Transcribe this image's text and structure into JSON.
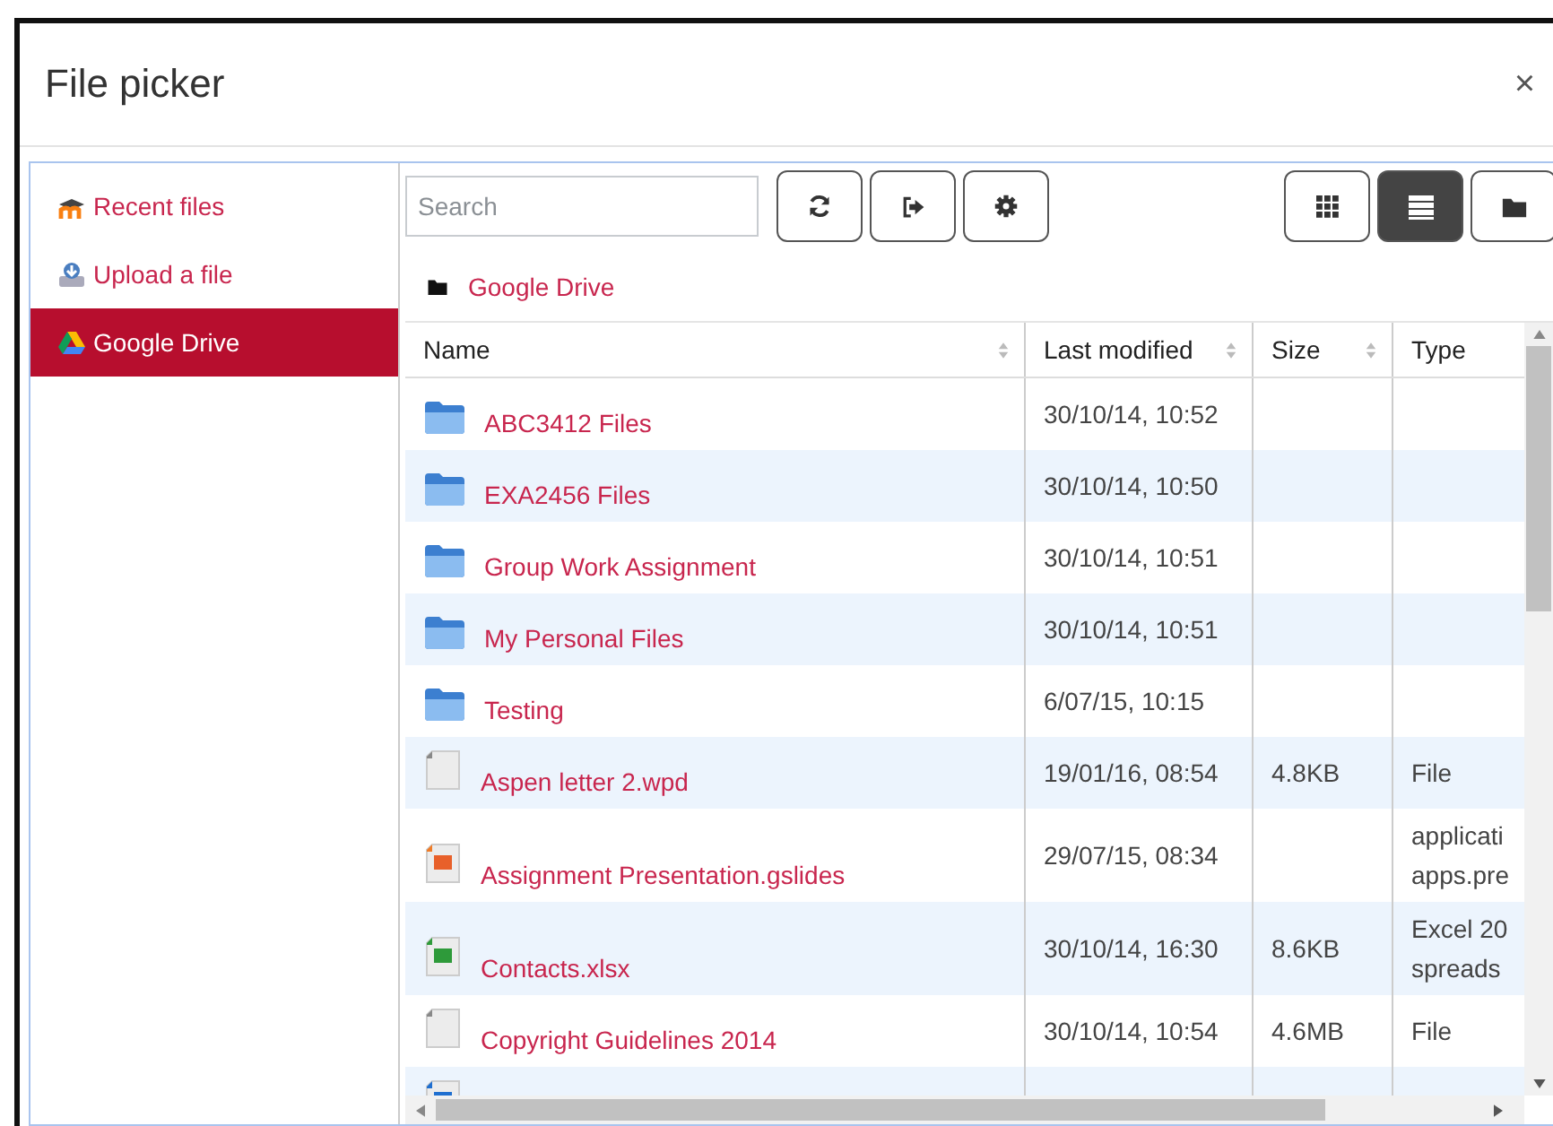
{
  "dialog": {
    "title": "File picker",
    "close": "×"
  },
  "sidebar": {
    "items": [
      {
        "label": "Recent files",
        "kind": "recent",
        "selected": false
      },
      {
        "label": "Upload a file",
        "kind": "upload",
        "selected": false
      },
      {
        "label": "Google Drive",
        "kind": "drive",
        "selected": true
      }
    ]
  },
  "toolbar": {
    "search": {
      "placeholder": "Search"
    },
    "views": [
      {
        "kind": "icons",
        "selected": false
      },
      {
        "kind": "list",
        "selected": true
      },
      {
        "kind": "tree",
        "selected": false
      }
    ]
  },
  "breadcrumb": "Google Drive",
  "table": {
    "columns": [
      "Name",
      "Last modified",
      "Size",
      "Type"
    ],
    "rows": [
      {
        "kind": "folder",
        "name": "ABC3412 Files",
        "modified": "30/10/14, 10:52"
      },
      {
        "kind": "folder",
        "name": "EXA2456 Files",
        "modified": "30/10/14, 10:50"
      },
      {
        "kind": "folder",
        "name": "Group Work Assignment",
        "modified": "30/10/14, 10:51"
      },
      {
        "kind": "folder",
        "name": "My Personal Files",
        "modified": "30/10/14, 10:51"
      },
      {
        "kind": "folder",
        "name": "Testing",
        "modified": "6/07/15, 10:15"
      },
      {
        "kind": "file",
        "name": "Aspen letter 2.wpd",
        "modified": "19/01/16, 08:54",
        "size": "4.8KB",
        "type": [
          "File"
        ]
      },
      {
        "kind": "slides",
        "name": "Assignment Presentation.gslides",
        "modified": "29/07/15, 08:34",
        "type": [
          "applicati",
          "apps.pre"
        ]
      },
      {
        "kind": "sheet",
        "name": "Contacts.xlsx",
        "modified": "30/10/14, 16:30",
        "size": "8.6KB",
        "type": [
          "Excel 20",
          "spreads"
        ]
      },
      {
        "kind": "file",
        "name": "Copyright Guidelines 2014",
        "modified": "30/10/14, 10:54",
        "size": "4.6MB",
        "type": [
          "File"
        ]
      },
      {
        "kind": "doc"
      }
    ]
  }
}
